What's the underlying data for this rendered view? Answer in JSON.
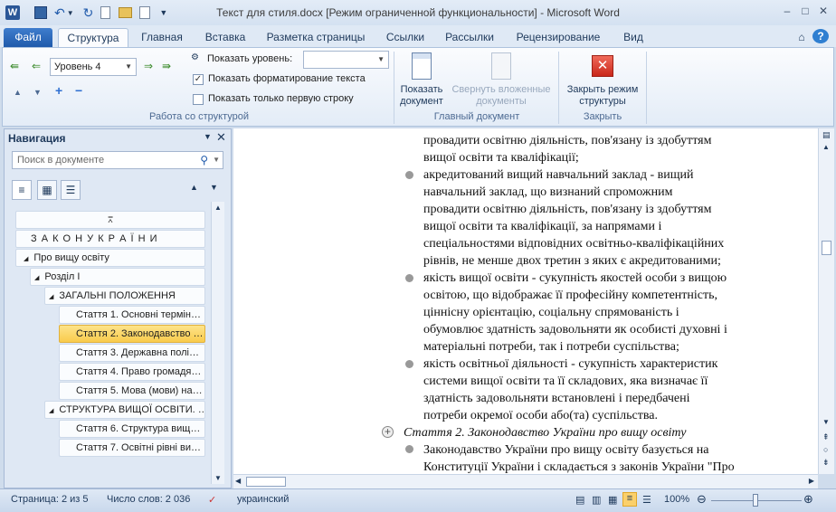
{
  "window": {
    "title": "Текст для стиля.docx [Режим ограниченной функциональности]  -  Microsoft Word"
  },
  "tabs": [
    {
      "label": "Файл"
    },
    {
      "label": "Структура"
    },
    {
      "label": "Главная"
    },
    {
      "label": "Вставка"
    },
    {
      "label": "Разметка страницы"
    },
    {
      "label": "Ссылки"
    },
    {
      "label": "Рассылки"
    },
    {
      "label": "Рецензирование"
    },
    {
      "label": "Вид"
    }
  ],
  "ribbon": {
    "level_value": "Уровень 4",
    "show_level_label": "Показать уровень:",
    "show_level_value": "",
    "show_formatting_label": "Показать форматирование текста",
    "show_formatting_checked": true,
    "first_line_label": "Показать только первую строку",
    "first_line_checked": false,
    "group_outline_label": "Работа со структурой",
    "show_document_label": "Показать документ",
    "collapse_subdocs_label": "Свернуть вложенные документы",
    "group_master_label": "Главный документ",
    "close_outline_label": "Закрыть режим структуры",
    "group_close_label": "Закрыть"
  },
  "nav": {
    "title": "Навигация",
    "search_placeholder": "Поиск в документе",
    "items": [
      {
        "label": "З А К О Н   У К Р А Ї Н И",
        "expander": ""
      },
      {
        "label": "Про вищу освіту",
        "expander": "◢"
      },
      {
        "label": "Розділ І",
        "expander": "◢"
      },
      {
        "label": "ЗАГАЛЬНІ ПОЛОЖЕННЯ",
        "expander": "◢"
      },
      {
        "label": "Стаття 1. Основні термін…",
        "expander": ""
      },
      {
        "label": "Стаття 2. Законодавство …",
        "expander": ""
      },
      {
        "label": "Стаття 3. Державна полі…",
        "expander": ""
      },
      {
        "label": "Стаття 4. Право громадя…",
        "expander": ""
      },
      {
        "label": "Стаття 5. Мова (мови) на…",
        "expander": ""
      },
      {
        "label": "СТРУКТУРА ВИЩОЇ ОСВІТИ. …",
        "expander": "◢"
      },
      {
        "label": "Стаття 6. Структура вищ…",
        "expander": ""
      },
      {
        "label": "Стаття 7. Освітні рівні ви…",
        "expander": ""
      }
    ]
  },
  "doc": {
    "lines_top": [
      "провадити освітню діяльність, пов'язану із здобуттям",
      "вищої освіти та кваліфікації;"
    ],
    "p1": [
      "акредитований вищий навчальний заклад - вищий",
      "навчальний заклад, що визнаний спроможним",
      "провадити освітню діяльність, пов'язану із здобуттям",
      "вищої освіти та кваліфікації, за напрямами і",
      "спеціальностями відповідних освітньо-кваліфікаційних",
      "рівнів, не менше двох третин з яких є акредитованими;"
    ],
    "p2": [
      "якість вищої освіти - сукупність якостей особи з вищою",
      "освітою, що відображає її професійну компетентність,",
      "ціннісну орієнтацію, соціальну спрямованість і",
      "обумовлює здатність задовольняти як особисті духовні і",
      "матеріальні потреби, так і потреби суспільства;"
    ],
    "p3": [
      "якість освітньої діяльності - сукупність характеристик",
      "системи вищої освіти та її складових, яка визначає її",
      "здатність задовольняти встановлені і передбачені",
      "потреби окремої особи або(та) суспільства."
    ],
    "heading": "Стаття 2. Законодавство України про вищу освіту",
    "p4": [
      "Законодавство України про вищу освіту базується на",
      "Конституції України і складається з законів України \"Про"
    ]
  },
  "status": {
    "page": "Страница: 2 из 5",
    "words": "Число слов: 2 036",
    "language": "украинский",
    "zoom": "100%"
  }
}
